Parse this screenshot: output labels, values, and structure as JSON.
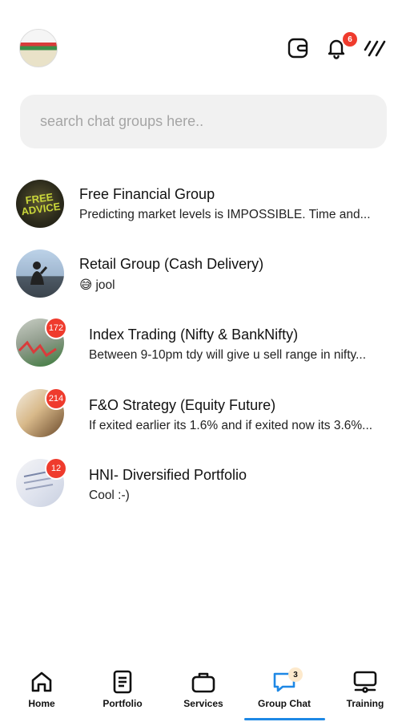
{
  "header": {
    "notifications_count": "6",
    "logo_icon": "brand-logo",
    "wallet_icon": "wallet-icon",
    "bell_icon": "bell-icon",
    "menu_icon": "menu-icon"
  },
  "search": {
    "placeholder": "search chat groups here.."
  },
  "groups": [
    {
      "name": "Free Financial Group",
      "last_message": "Predicting market levels is IMPOSSIBLE. Time and...",
      "avatar_text": "FREE ADVICE"
    },
    {
      "name": "Retail Group (Cash Delivery)",
      "last_message": "jool",
      "emoji": "😅"
    },
    {
      "name": "Index Trading (Nifty & BankNifty)",
      "last_message": "Between 9-10pm tdy will give u sell range in nifty...",
      "unread": "172"
    },
    {
      "name": "F&O Strategy (Equity Future)",
      "last_message": "If exited earlier its 1.6% and if exited now its 3.6%...",
      "unread": "214"
    },
    {
      "name": "HNI- Diversified Portfolio",
      "last_message": "Cool :-)",
      "unread": "12"
    }
  ],
  "tabs": [
    {
      "label": "Home",
      "icon": "home-icon"
    },
    {
      "label": "Portfolio",
      "icon": "document-icon"
    },
    {
      "label": "Services",
      "icon": "briefcase-icon"
    },
    {
      "label": "Group Chat",
      "icon": "chat-icon",
      "badge": "3",
      "active": true
    },
    {
      "label": "Training",
      "icon": "monitor-icon"
    }
  ],
  "colors": {
    "accent": "#1e88e5",
    "badge_red": "#ef3b2d",
    "chat_icon": "#1e88e5"
  }
}
